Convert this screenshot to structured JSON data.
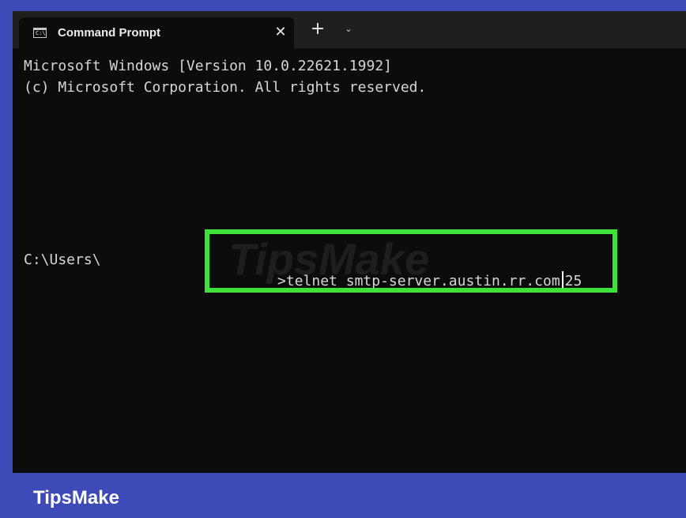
{
  "window": {
    "tab_title": "Command Prompt",
    "tab_icon_text": "C:\\",
    "close_glyph": "✕",
    "new_tab_glyph": "+",
    "dropdown_glyph": "⌄"
  },
  "terminal": {
    "lines": [
      "Microsoft Windows [Version 10.0.22621.1992]",
      "(c) Microsoft Corporation. All rights reserved."
    ],
    "prompt_path": "C:\\Users\\",
    "command_before_cursor": ">telnet smtp-server.austin.rr.com",
    "command_after_cursor": "25"
  },
  "watermark": {
    "text": "TipsMake"
  },
  "footer": {
    "brand": "TipsMake"
  },
  "colors": {
    "background": "#3d4ab8",
    "terminal_background": "#0c0c0c",
    "tab_bar": "#1f1f1f",
    "terminal_text": "#d6d6d6",
    "highlight": "#3ee13a"
  }
}
